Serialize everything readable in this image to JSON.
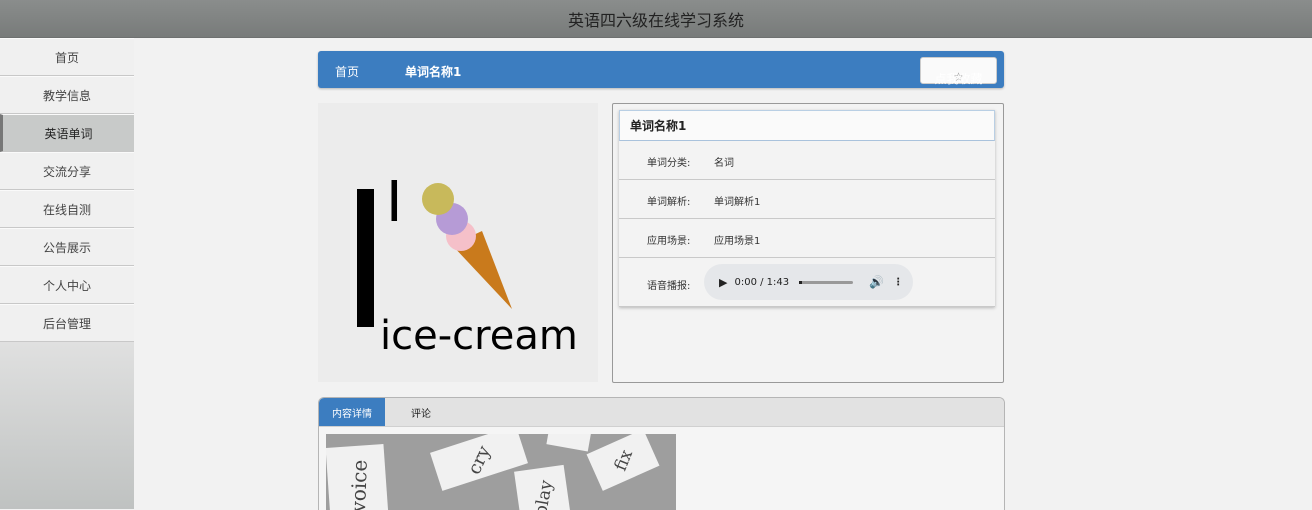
{
  "app": {
    "title": "英语四六级在线学习系统"
  },
  "sidebar": {
    "items": [
      {
        "label": "首页"
      },
      {
        "label": "教学信息"
      },
      {
        "label": "英语单词",
        "active": true
      },
      {
        "label": "交流分享"
      },
      {
        "label": "在线自测"
      },
      {
        "label": "公告展示"
      },
      {
        "label": "个人中心"
      },
      {
        "label": "后台管理"
      }
    ]
  },
  "breadcrumb": {
    "home": "首页",
    "current": "单词名称1",
    "favorite_label": "点我收藏",
    "favorite_icon": "star-outline-icon"
  },
  "word_image": {
    "letter": "I",
    "caption": "ice-cream"
  },
  "detail": {
    "title": "单词名称1",
    "rows": [
      {
        "label": "单词分类:",
        "value": "名词"
      },
      {
        "label": "单词解析:",
        "value": "单词解析1"
      },
      {
        "label": "应用场景:",
        "value": "应用场景1"
      }
    ],
    "audio": {
      "label": "语音播报:",
      "time": "0:00 / 1:43",
      "progress": 0.0
    }
  },
  "tabs": [
    {
      "label": "内容详情",
      "active": true
    },
    {
      "label": "评论",
      "active": false
    }
  ],
  "photo_words": [
    "voice",
    "cry",
    "play",
    "fix"
  ],
  "colors": {
    "accent": "#3c7dc0",
    "topbar": "#808382"
  }
}
